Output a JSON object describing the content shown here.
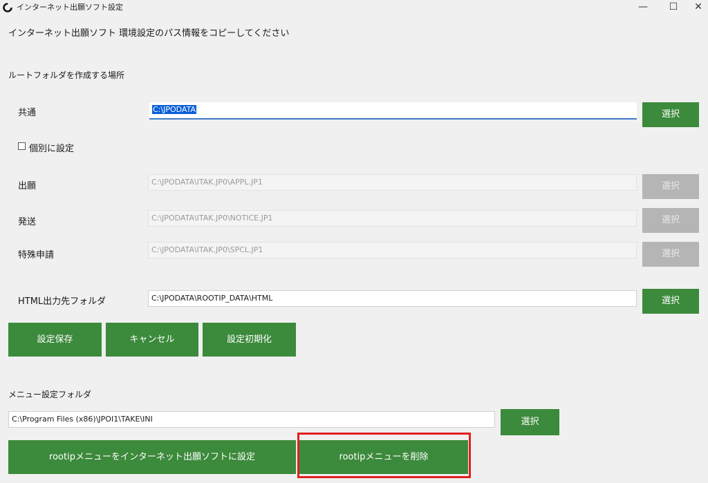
{
  "window": {
    "title": "インターネット出願ソフト設定",
    "minimize": "—",
    "maximize": "☐",
    "close": "✕"
  },
  "instruction": "インターネット出願ソフト 環境設定のパス情報をコピーしてください",
  "root_section": {
    "heading": "ルートフォルダを作成する場所",
    "common": {
      "label": "共通",
      "value": "C:\\JPODATA",
      "button": "選択"
    },
    "individual_checkbox": {
      "label": "個別に設定",
      "checked": false
    },
    "application": {
      "label": "出願",
      "value": "C:\\JPODATA\\ITAK.JP0\\APPL.JP1",
      "button": "選択"
    },
    "dispatch": {
      "label": "発送",
      "value": "C:\\JPODATA\\ITAK.JP0\\NOTICE.JP1",
      "button": "選択"
    },
    "special": {
      "label": "特殊申請",
      "value": "C:\\JPODATA\\ITAK.JP0\\SPCL.JP1",
      "button": "選択"
    },
    "html_output": {
      "label": "HTML出力先フォルダ",
      "value": "C:\\JPODATA\\ROOTIP_DATA\\HTML",
      "button": "選択"
    }
  },
  "actions": {
    "save": "設定保存",
    "cancel": "キャンセル",
    "reset": "設定初期化"
  },
  "menu_section": {
    "heading": "メニュー設定フォルダ",
    "value": "C:\\Program Files (x86)\\JPOI1\\TAKE\\INI",
    "button": "選択",
    "set_menu": "rootipメニューをインターネット出願ソフトに設定",
    "delete_menu": "rootipメニューを削除"
  },
  "colors": {
    "button_green": "#3c8a3c",
    "disabled_gray": "#b5b5b5",
    "highlight_red": "#e02020",
    "focus_underline": "#3f7ac6"
  }
}
